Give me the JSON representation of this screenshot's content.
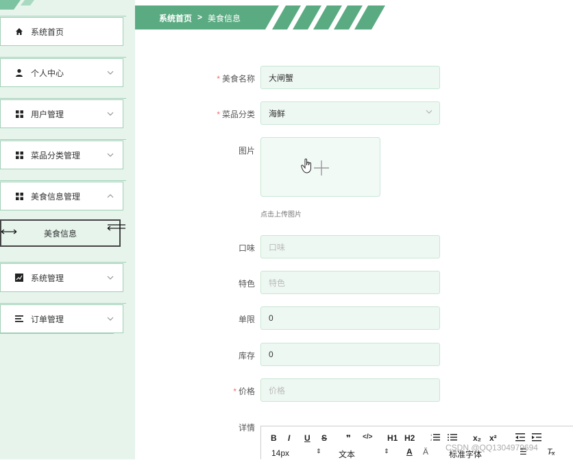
{
  "sidebar": {
    "items": [
      {
        "label": "系统首页",
        "icon": "home-icon",
        "expandable": false
      },
      {
        "label": "个人中心",
        "icon": "user-icon",
        "expandable": true
      },
      {
        "label": "用户管理",
        "icon": "grid-icon",
        "expandable": true
      },
      {
        "label": "菜品分类管理",
        "icon": "grid-icon",
        "expandable": true
      },
      {
        "label": "美食信息管理",
        "icon": "grid-icon",
        "expandable": true,
        "expanded": true
      },
      {
        "label": "系统管理",
        "icon": "chart-icon",
        "expandable": true
      },
      {
        "label": "订单管理",
        "icon": "list-icon",
        "expandable": true
      }
    ],
    "sub_item": {
      "label": "美食信息"
    }
  },
  "breadcrumb": {
    "home": "系统首页",
    "separator": ">",
    "current": "美食信息"
  },
  "form": {
    "name": {
      "label": "美食名称",
      "required": true,
      "value": "大闸蟹"
    },
    "category": {
      "label": "菜品分类",
      "required": true,
      "value": "海鲜"
    },
    "image": {
      "label": "图片",
      "hint": "点击上传图片"
    },
    "taste": {
      "label": "口味",
      "placeholder": "口味"
    },
    "feature": {
      "label": "特色",
      "placeholder": "特色"
    },
    "limit": {
      "label": "单限",
      "value": "0"
    },
    "stock": {
      "label": "库存",
      "value": "0"
    },
    "price": {
      "label": "价格",
      "required": true,
      "placeholder": "价格"
    },
    "detail": {
      "label": "详情"
    }
  },
  "editor": {
    "buttons": [
      "B",
      "I",
      "U",
      "S",
      "❞",
      "</>",
      "H1",
      "H2",
      "ol",
      "ul",
      "x₂",
      "x²",
      "outdent",
      "indent"
    ],
    "font_size": "14px",
    "paragraph": "文本",
    "font_family": "标准字体"
  },
  "watermark": "CSDN @QQ1304979694",
  "colors": {
    "accent": "#5aab82",
    "sidebar_bg": "#e6f4ec",
    "required": "#f56c6c"
  }
}
